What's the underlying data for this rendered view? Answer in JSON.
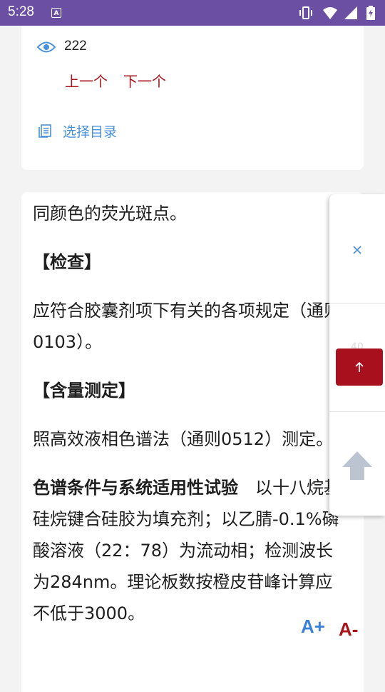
{
  "status_bar": {
    "time": "5:28",
    "notification_icon": "A"
  },
  "article": {
    "views": "222",
    "prev_label": "上一个",
    "next_label": "下一个",
    "catalog_label": "选择目录"
  },
  "content": {
    "p1": "同颜色的荧光斑点。",
    "h_check": "【检查】",
    "p2": "应符合胶囊剂项下有关的各项规定（通则0103）。",
    "h_assay": "【含量测定】",
    "p3": "照高效液相色谱法（通则0512）测定。",
    "p4_bold": "色谱条件与系统适用性试验",
    "p4_rest": "　以十八烷基硅烷键合硅胶为填充剂；以乙腈-0.1%磷酸溶液（22：78）为流动相；检测波长为284nm。理论板数按橙皮苷峰计算应不低于3000。"
  },
  "float_panel": {
    "faint_text": "40",
    "close_icon": "close-icon",
    "scroll_top_icon": "arrow-up-icon"
  },
  "font_controls": {
    "increase": "A+",
    "decrease": "A-"
  },
  "colors": {
    "status_bar": "#6a4fa3",
    "accent_red": "#a8141c",
    "link_blue": "#4a90d9"
  }
}
